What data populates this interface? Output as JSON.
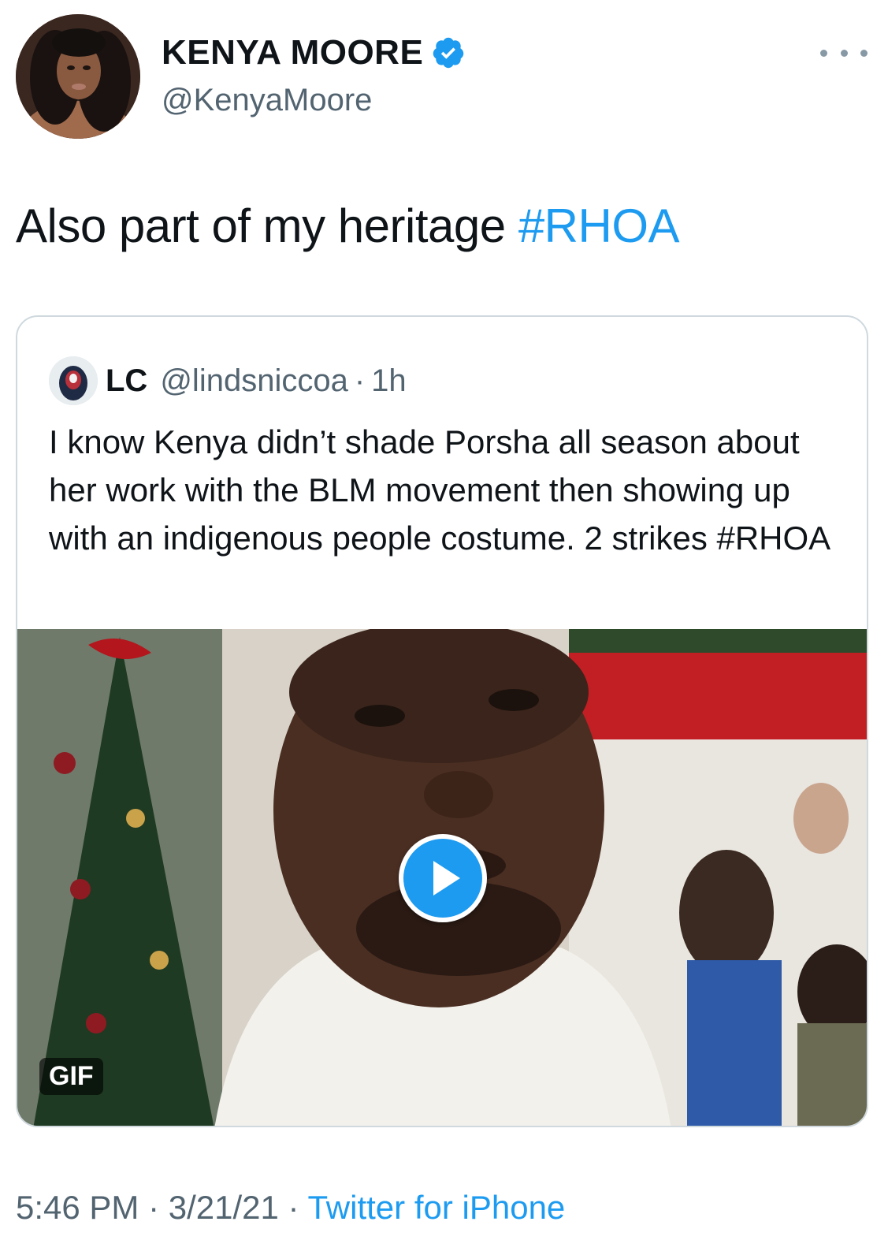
{
  "author": {
    "display_name": "KENYA MOORE",
    "handle": "@KenyaMoore",
    "verified": true,
    "avatar_icon": "profile-photo"
  },
  "tweet": {
    "text": "Also part of my heritage ",
    "hashtag": "#RHOA"
  },
  "quoted_tweet": {
    "name": "LC",
    "handle": "@lindsniccoa",
    "separator": "·",
    "time": "1h",
    "text": "I know Kenya didn’t shade Porsha all season about her work with the BLM movement then showing up with an indigenous people costume. 2 strikes  #RHOA",
    "media": {
      "type": "gif",
      "badge": "GIF",
      "play_icon": "play-icon"
    }
  },
  "meta": {
    "time": "5:46 PM",
    "sep1": " · ",
    "date": "3/21/21",
    "sep2": " · ",
    "source": "Twitter for iPhone"
  },
  "colors": {
    "accent": "#1d9bf0",
    "secondary_text": "#536471",
    "border": "#cfd9de"
  }
}
